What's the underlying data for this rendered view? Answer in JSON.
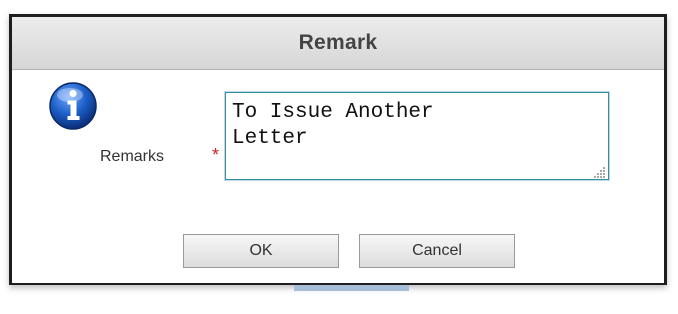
{
  "dialog": {
    "title": "Remark",
    "icon": "info-icon",
    "remarks_label": "Remarks",
    "required_marker": "*",
    "remarks_value": "To Issue Another\nLetter",
    "ok_label": "OK",
    "cancel_label": "Cancel"
  },
  "colors": {
    "accent": "#3a8aa8",
    "required": "#cc2222",
    "icon_blue": "#1c5fc7"
  }
}
